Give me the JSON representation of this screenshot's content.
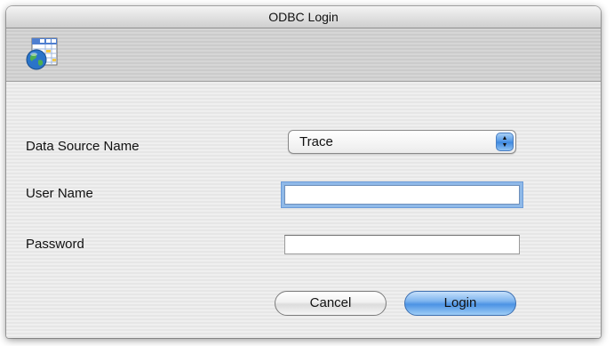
{
  "window": {
    "title": "ODBC Login",
    "icon": "database-globe-icon"
  },
  "form": {
    "data_source": {
      "label": "Data Source Name",
      "selected_value": "Trace"
    },
    "user_name": {
      "label": "User Name",
      "value": ""
    },
    "password": {
      "label": "Password",
      "value": ""
    }
  },
  "buttons": {
    "cancel_label": "Cancel",
    "login_label": "Login"
  },
  "colors": {
    "accent": "#4c93e4",
    "window_bg": "#ececec"
  }
}
